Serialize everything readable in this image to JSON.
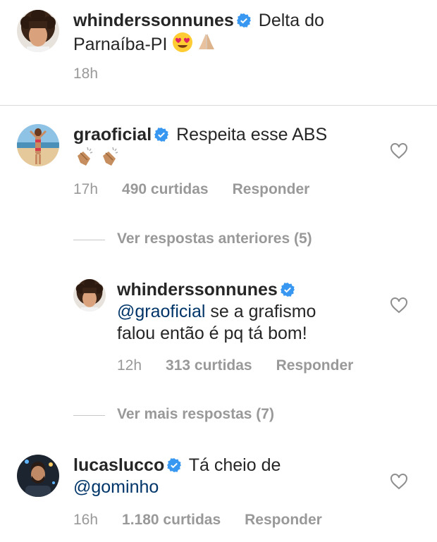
{
  "post": {
    "username": "whinderssonnunes",
    "caption_line1": "Delta do",
    "caption_line2": "Parnaíba-PI",
    "emoji_names": [
      "heart-eyes-emoji",
      "folded-hands-emoji"
    ],
    "time": "18h"
  },
  "comments": [
    {
      "username": "graoficial",
      "text": "Respeita esse ABS",
      "emoji_names": [
        "clapping-hands-emoji",
        "clapping-hands-emoji"
      ],
      "time": "17h",
      "likes": "490 curtidas",
      "reply_label": "Responder"
    },
    {
      "username": "lucaslucco",
      "text_line1": "Tá cheio de",
      "mention": "@gominho",
      "time": "16h",
      "likes": "1.180 curtidas",
      "reply_label": "Responder"
    }
  ],
  "view_previous_replies": "Ver respostas anteriores (5)",
  "reply": {
    "username": "whinderssonnunes",
    "mention": "@graoficial",
    "text_line1": "se a grafismo",
    "text_line2": "falou então é pq tá bom!",
    "time": "12h",
    "likes": "313 curtidas",
    "reply_label": "Responder"
  },
  "view_more_replies": "Ver mais respostas (7)",
  "colors": {
    "text": "#262626",
    "secondary": "#999999",
    "mention": "#003569",
    "verified": "#3897f0",
    "divider": "#dbdbdb"
  }
}
